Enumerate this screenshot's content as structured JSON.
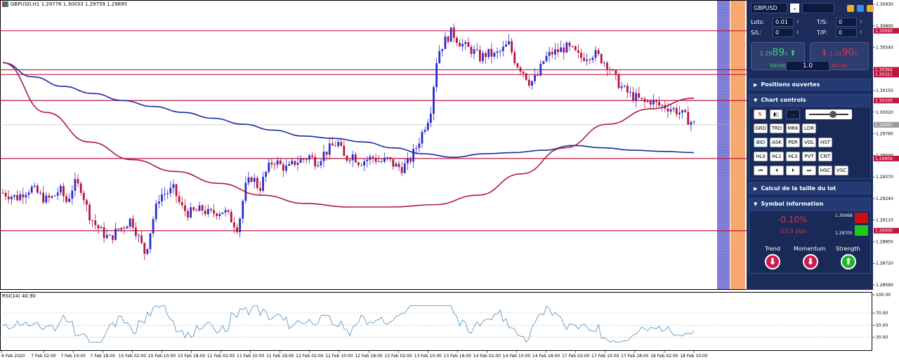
{
  "title": "GBPUSD,H1  1.29776 1.30033 1.29759 1.29895",
  "rsi_label": "RSI(14) 40.90",
  "colors": {
    "candle_up": "#2b2bd0",
    "candle_down": "#b8133b",
    "ma_slow": "#1a2aa0",
    "ma_fast": "#b01840",
    "hline": "#c0173f",
    "rsi": "#4a8fbf",
    "panel_bg": "#1c2b5a"
  },
  "chart_data": {
    "type": "candlestick",
    "symbol": "GBPUSD",
    "timeframe": "H1",
    "ylim": [
      1.285,
      1.3095
    ],
    "y_ticks": [
      "1.30930",
      "1.30800",
      "1.30540",
      "1.30280",
      "1.30150",
      "1.30020",
      "1.29760",
      "1.29500",
      "1.29370",
      "1.29240",
      "1.29110",
      "1.28850",
      "1.28720",
      "1.28590"
    ],
    "x_labels": [
      "6 Feb 2020",
      "7 Feb 02:00",
      "7 Feb 10:00",
      "7 Feb 18:00",
      "10 Feb 02:00",
      "10 Feb 10:00",
      "10 Feb 18:00",
      "11 Feb 02:00",
      "11 Feb 10:00",
      "11 Feb 18:00",
      "12 Feb 02:00",
      "12 Feb 10:00",
      "12 Feb 18:00",
      "13 Feb 02:00",
      "13 Feb 10:00",
      "13 Feb 18:00",
      "14 Feb 02:00",
      "14 Feb 10:00",
      "14 Feb 18:00",
      "17 Feb 02:00",
      "17 Feb 10:00",
      "17 Feb 18:00",
      "18 Feb 02:00",
      "18 Feb 10:00"
    ],
    "close_path": [
      1.2932,
      1.293,
      1.2928,
      1.2933,
      1.2936,
      1.2931,
      1.2926,
      1.2928,
      1.2935,
      1.2924,
      1.294,
      1.2936,
      1.2915,
      1.2905,
      1.2898,
      1.2893,
      1.29,
      1.2904,
      1.291,
      1.2895,
      1.288,
      1.2908,
      1.293,
      1.2932,
      1.2935,
      1.292,
      1.2915,
      1.2916,
      1.2918,
      1.2914,
      1.2916,
      1.2917,
      1.291,
      1.2902,
      1.2936,
      1.2946,
      1.2935,
      1.295,
      1.296,
      1.2955,
      1.2952,
      1.2958,
      1.296,
      1.2963,
      1.2958,
      1.2965,
      1.297,
      1.2975,
      1.296,
      1.2965,
      1.2958,
      1.296,
      1.2962,
      1.2958,
      1.296,
      1.2955,
      1.2953,
      1.2958,
      1.297,
      1.2985,
      1.3,
      1.305,
      1.306,
      1.3068,
      1.306,
      1.3055,
      1.3052,
      1.3046,
      1.305,
      1.3048,
      1.3052,
      1.3058,
      1.3042,
      1.3035,
      1.3025,
      1.303,
      1.3045,
      1.305,
      1.3052,
      1.3055,
      1.3052,
      1.3046,
      1.3048,
      1.305,
      1.3045,
      1.304,
      1.3028,
      1.302,
      1.3015,
      1.3012,
      1.3008,
      1.301,
      1.3006,
      1.3005,
      1.3003,
      1.3,
      1.2995,
      1.299
    ],
    "ma_slow": [
      1.3042,
      1.303,
      1.3022,
      1.3016,
      1.301,
      1.3005,
      1.3,
      1.2995,
      1.299,
      1.2985,
      1.298,
      1.2978,
      1.2975,
      1.297,
      1.2965,
      1.2962,
      1.2965,
      1.2966,
      1.2968,
      1.2972,
      1.297,
      1.2968,
      1.2967,
      1.2966
    ],
    "ma_fast": [
      1.3042,
      1.3,
      1.2975,
      1.296,
      1.295,
      1.294,
      1.293,
      1.2923,
      1.292,
      1.292,
      1.2922,
      1.293,
      1.2948,
      1.297,
      1.299,
      1.3003,
      1.3012
    ],
    "horizontal_levels": [
      1.3069,
      1.3036,
      1.3032,
      1.301,
      1.2961,
      1.29
    ],
    "level_labels": [
      "1.30690",
      "1.30364",
      "1.30321",
      "1.30100",
      "1.29609",
      "1.29000"
    ],
    "current_price": 1.29895,
    "current_label": "1.29895",
    "rsi": {
      "period": 14,
      "value": 40.9,
      "ylim": [
        10,
        100
      ],
      "ticks": [
        "100.00",
        "70.00",
        "50.00",
        "30.00"
      ],
      "levels": [
        70,
        50,
        30
      ]
    }
  },
  "panel": {
    "symbol": "GBPUSD",
    "lots_label": "Lots:",
    "lots_value": "0.01",
    "ts_label": "T/S:",
    "ts_value": "0",
    "sl_label": "S/L:",
    "sl_value": "0",
    "tp_label": "T/P:",
    "tp_value": "0",
    "sell_price_small": "1.29",
    "sell_price_big": "89",
    "sell_price_sup": "5",
    "buy_price_small": "1.29",
    "buy_price_big": "90",
    "buy_price_sup": "5",
    "sell_label": "Vente",
    "buy_label": "Achat",
    "volume": "1.0",
    "positions_label": "Positions ouvertes",
    "chart_controls_label": "Chart controls",
    "buttons_row1": [
      "GRD",
      "TRD",
      "MRK",
      "LDR"
    ],
    "buttons_row2": [
      "BID",
      "ASK",
      "PER",
      "VOL",
      "HST"
    ],
    "buttons_row3": [
      "HL0",
      "HL1",
      "HLS",
      "PVT",
      "CNT"
    ],
    "buttons_row4": [
      "HSC",
      "VSC"
    ],
    "lot_calc_label": "Calcul de la taille du lot",
    "symbol_info_label": "Symbol information",
    "change_pct": "-0.10%",
    "change_pips": "-13.0 pips",
    "high_value": "1.30068",
    "low_value": "1.29705",
    "trend_label": "Trend",
    "momentum_label": "Momentum",
    "strength_label": "Strength"
  }
}
